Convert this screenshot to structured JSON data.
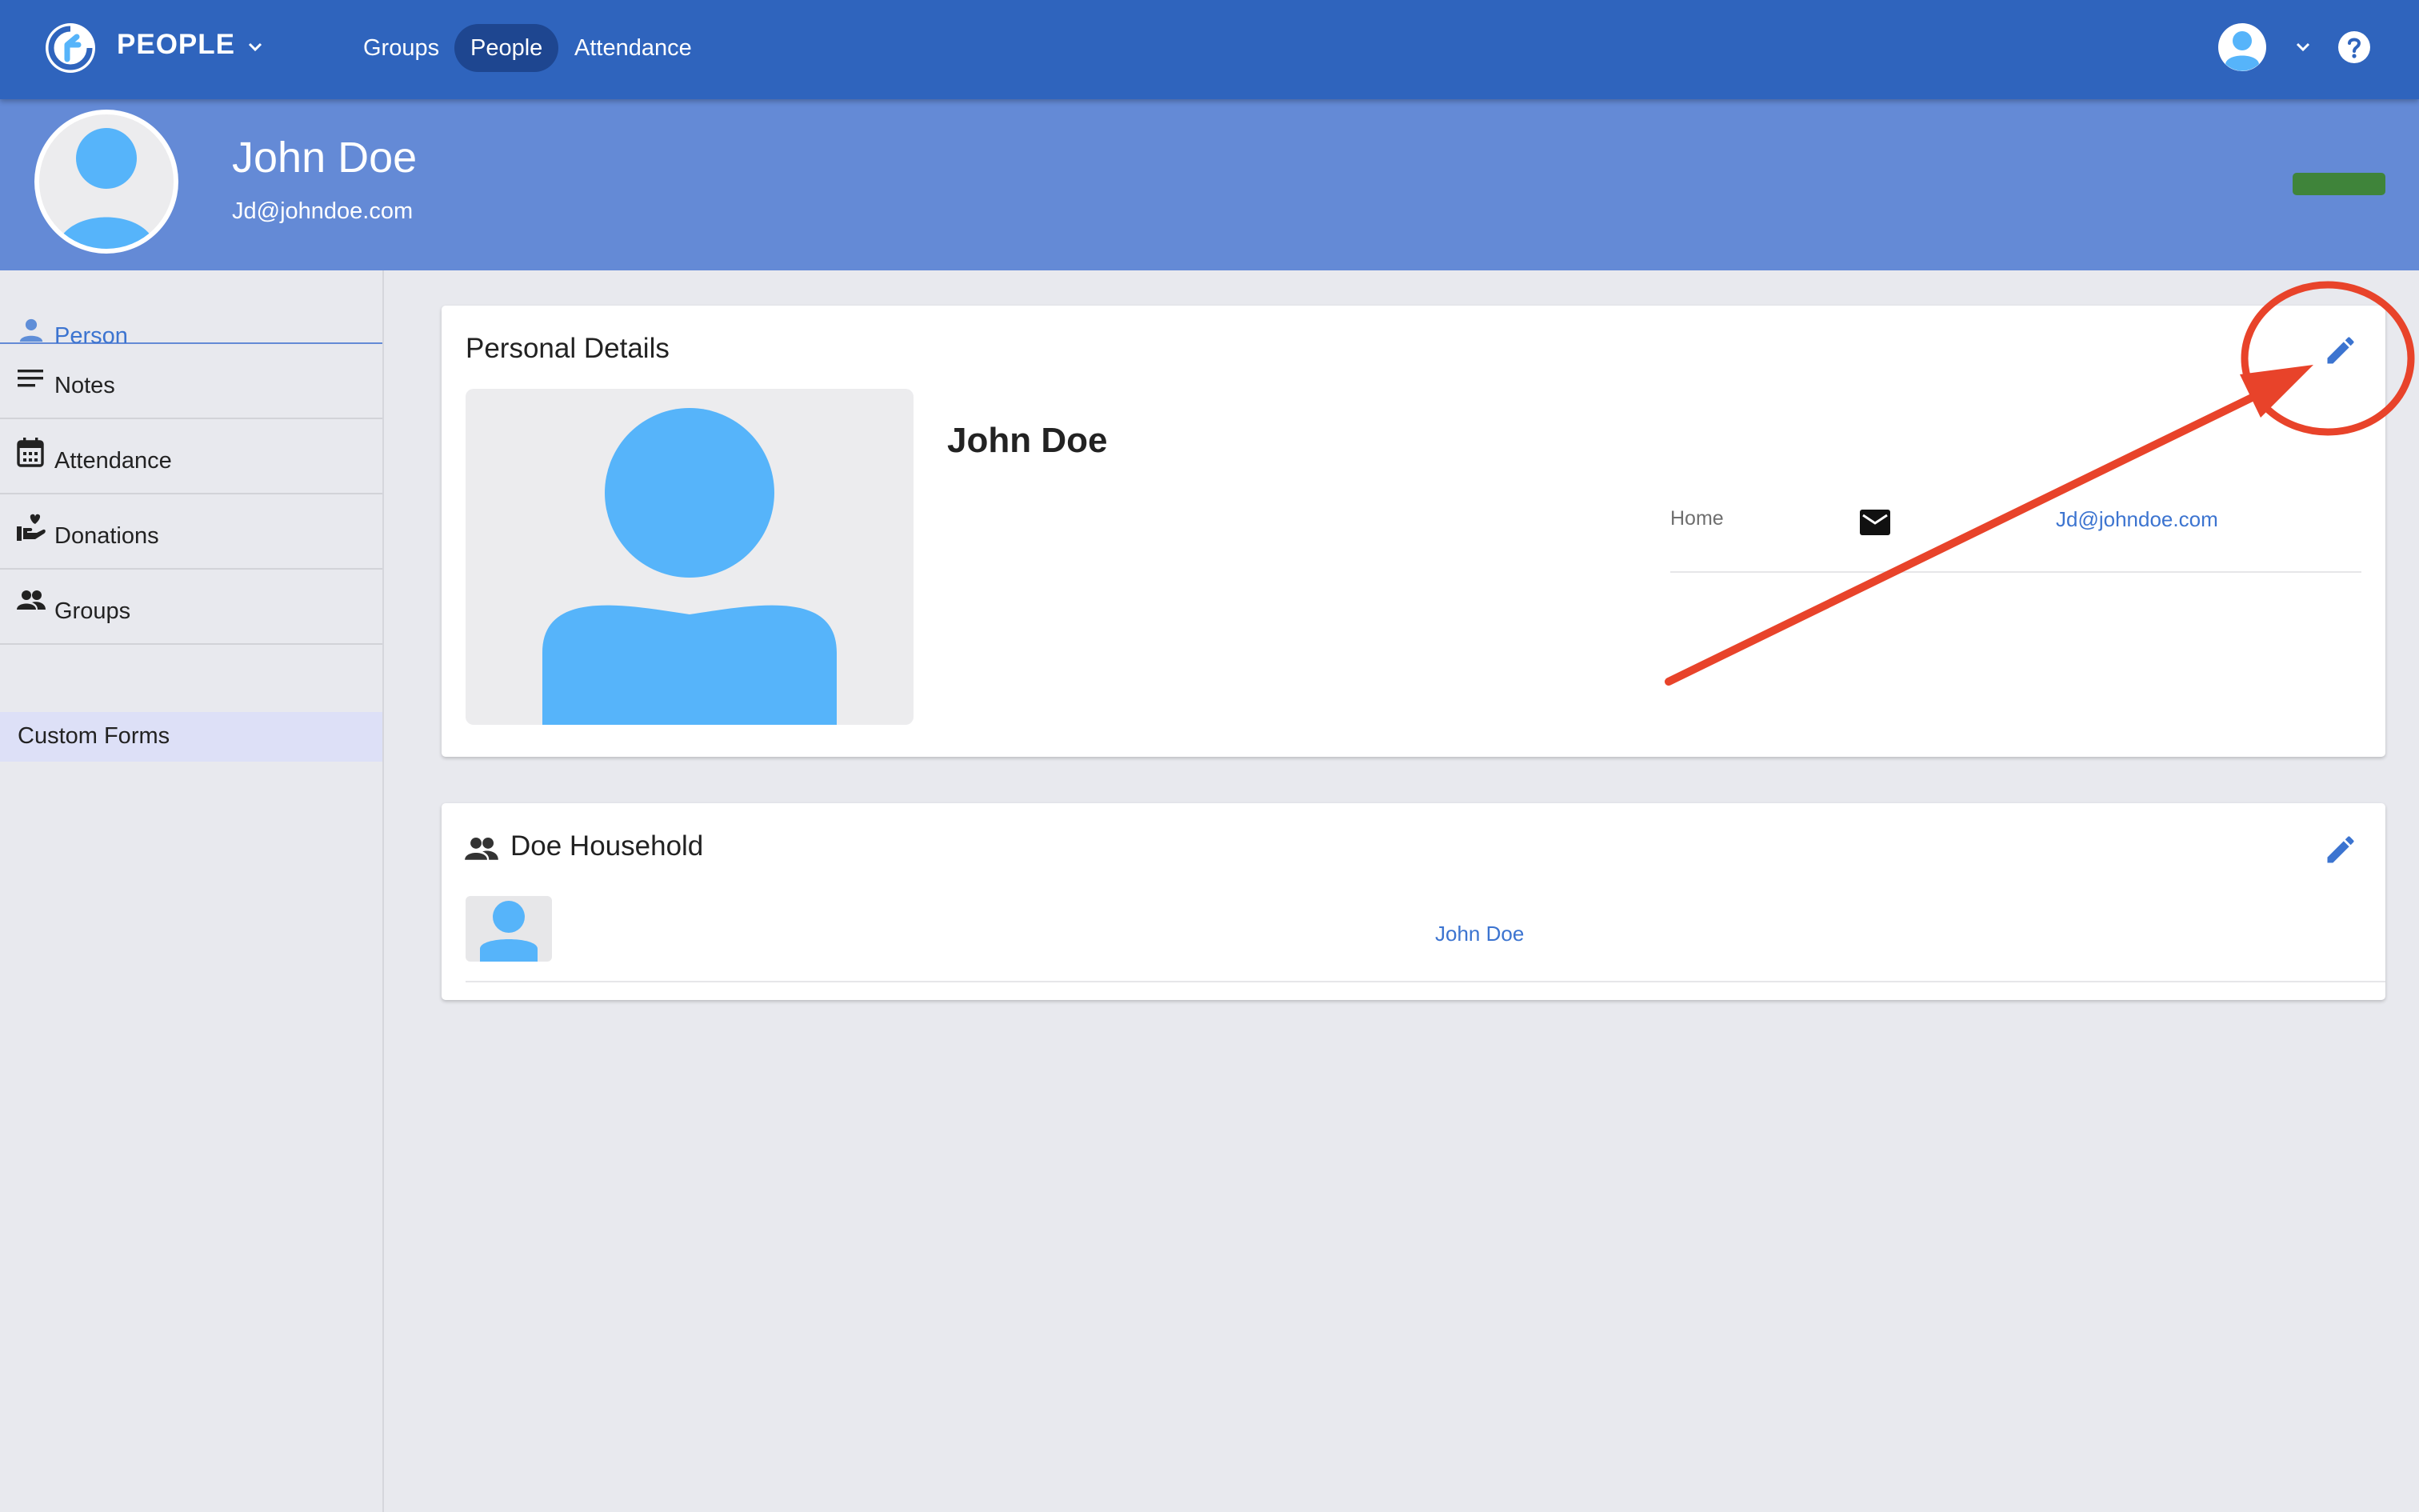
{
  "header": {
    "app_title": "PEOPLE",
    "nav": [
      {
        "label": "Groups"
      },
      {
        "label": "People",
        "active": true
      },
      {
        "label": "Attendance"
      }
    ]
  },
  "banner": {
    "name": "John Doe",
    "email": "Jd@johndoe.com"
  },
  "sidebar": {
    "items": [
      {
        "label": "Person",
        "icon": "person-icon",
        "active": true
      },
      {
        "label": "Notes",
        "icon": "notes-icon"
      },
      {
        "label": "Attendance",
        "icon": "calendar-icon"
      },
      {
        "label": "Donations",
        "icon": "donation-hand-icon"
      },
      {
        "label": "Groups",
        "icon": "groups-icon"
      }
    ],
    "custom_forms": "Custom Forms"
  },
  "personal_details": {
    "title": "Personal Details",
    "name": "John Doe",
    "contacts": [
      {
        "type": "Home",
        "icon": "mail-icon",
        "value": "Jd@johndoe.com"
      }
    ]
  },
  "household": {
    "title": "Doe Household",
    "members": [
      {
        "name": "John Doe"
      }
    ]
  },
  "colors": {
    "topbar": "#2f64bd",
    "banner": "#648ad6",
    "accent": "#3c74d0",
    "avatar": "#56b4fa",
    "annotation": "#e8432a"
  }
}
